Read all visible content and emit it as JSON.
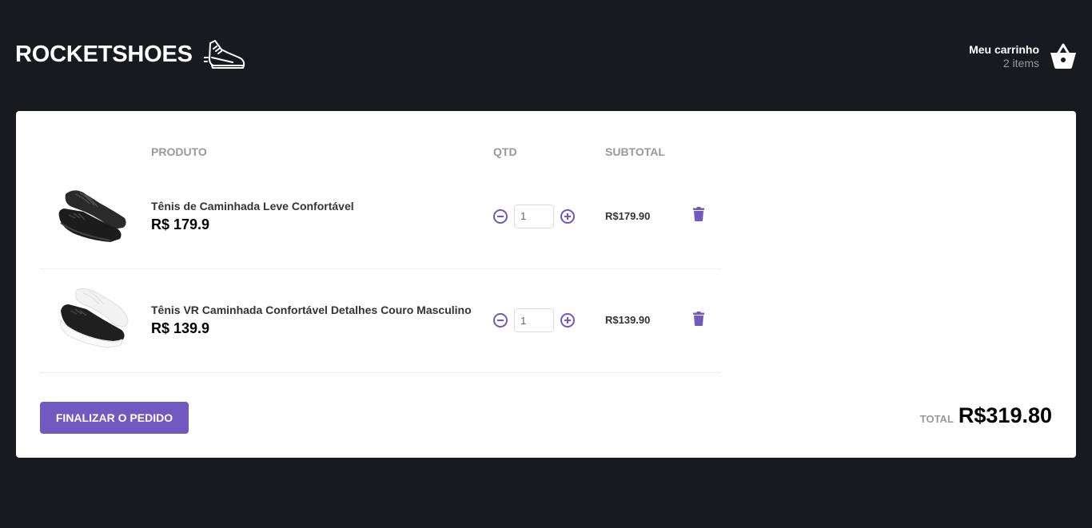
{
  "header": {
    "logo_text": "ROCKETSHOES",
    "cart_title": "Meu carrinho",
    "cart_count": "2 items"
  },
  "table": {
    "headers": {
      "produto": "PRODUTO",
      "qtd": "QTD",
      "subtotal": "SUBTOTAL"
    },
    "items": [
      {
        "name": "Tênis de Caminhada Leve Confortável",
        "price": "R$ 179.9",
        "quantity": "1",
        "subtotal": "R$179.90",
        "shoe_color": "black"
      },
      {
        "name": "Tênis VR Caminhada Confortável Detalhes Couro Masculino",
        "price": "R$ 139.9",
        "quantity": "1",
        "subtotal": "R$139.90",
        "shoe_color": "black-white"
      }
    ]
  },
  "footer": {
    "checkout_label": "FINALIZAR O PEDIDO",
    "total_label": "TOTAL",
    "total_value": "R$319.80"
  },
  "colors": {
    "background": "#191920",
    "accent": "#7159c1",
    "panel": "#ffffff"
  },
  "icons": {
    "logo": "running-shoe-icon",
    "cart": "shopping-basket-icon",
    "decrement": "minus-circle-icon",
    "increment": "plus-circle-icon",
    "delete": "trash-icon"
  }
}
